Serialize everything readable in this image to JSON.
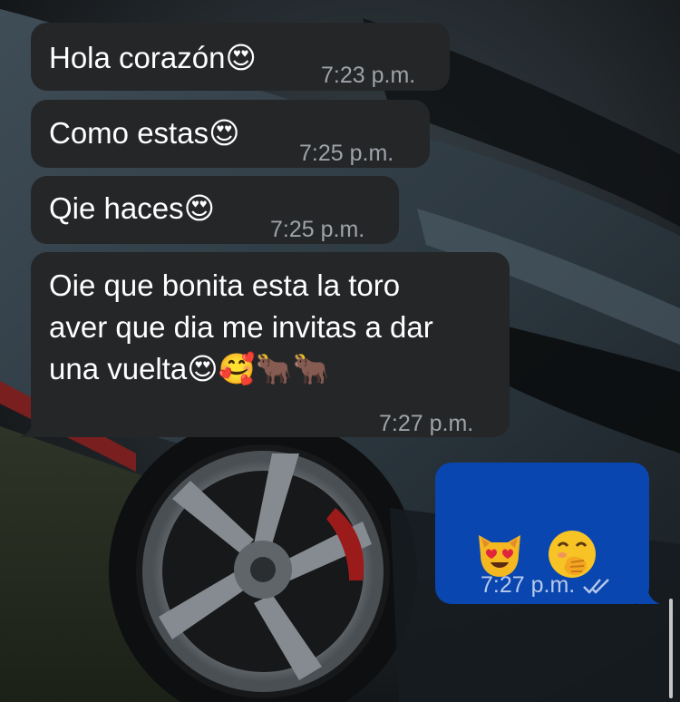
{
  "conversation": {
    "messages": [
      {
        "direction": "incoming",
        "text": "Hola corazón",
        "emojis": "😍",
        "time": "7:23 p.m."
      },
      {
        "direction": "incoming",
        "text": "Como estas",
        "emojis": "😍",
        "time": "7:25 p.m."
      },
      {
        "direction": "incoming",
        "text": "Qie haces",
        "emojis": "😍",
        "time": "7:25 p.m."
      },
      {
        "direction": "incoming",
        "text": "Oie que bonita esta la toro\naver que dia me invitas a dar\nuna vuelta",
        "emojis": "😍🥰🐂🐂",
        "time": "7:27 p.m."
      },
      {
        "direction": "outgoing",
        "text": "",
        "emojis": "😻 🤭",
        "time": "7:27 p.m.",
        "status": "read-double-check"
      }
    ]
  },
  "colors": {
    "incoming_bubble": "#242628",
    "outgoing_bubble": "#0a46b0",
    "timestamp": "#9ea3a8"
  }
}
